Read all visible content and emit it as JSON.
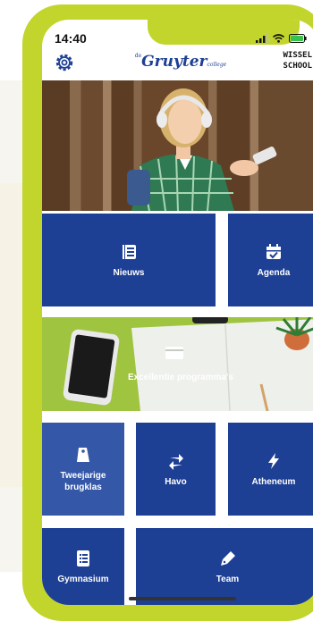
{
  "status_bar": {
    "time": "14:40"
  },
  "header": {
    "logo_prefix": "de",
    "logo_main": "Gruyter",
    "logo_sub": "college",
    "switch_school_line1": "WISSEL",
    "switch_school_line2": "SCHOOL"
  },
  "tiles": {
    "nieuws": "Nieuws",
    "agenda": "Agenda",
    "excellentie": "Excellentie programma's",
    "tweejarige_line1": "Tweejarige",
    "tweejarige_line2": "brugklas",
    "havo": "Havo",
    "atheneum": "Atheneum",
    "gymnasium": "Gymnasium",
    "team": "Team"
  },
  "colors": {
    "frame": "#c2d52c",
    "tile_blue": "#1d3f94",
    "tile_light_blue": "#3557a8"
  },
  "icons": [
    "settings-gear-icon",
    "newspaper-icon",
    "calendar-check-icon",
    "laptop-icon",
    "tag-icon",
    "arrows-swap-icon",
    "bolt-icon",
    "list-document-icon",
    "pen-nib-icon"
  ]
}
